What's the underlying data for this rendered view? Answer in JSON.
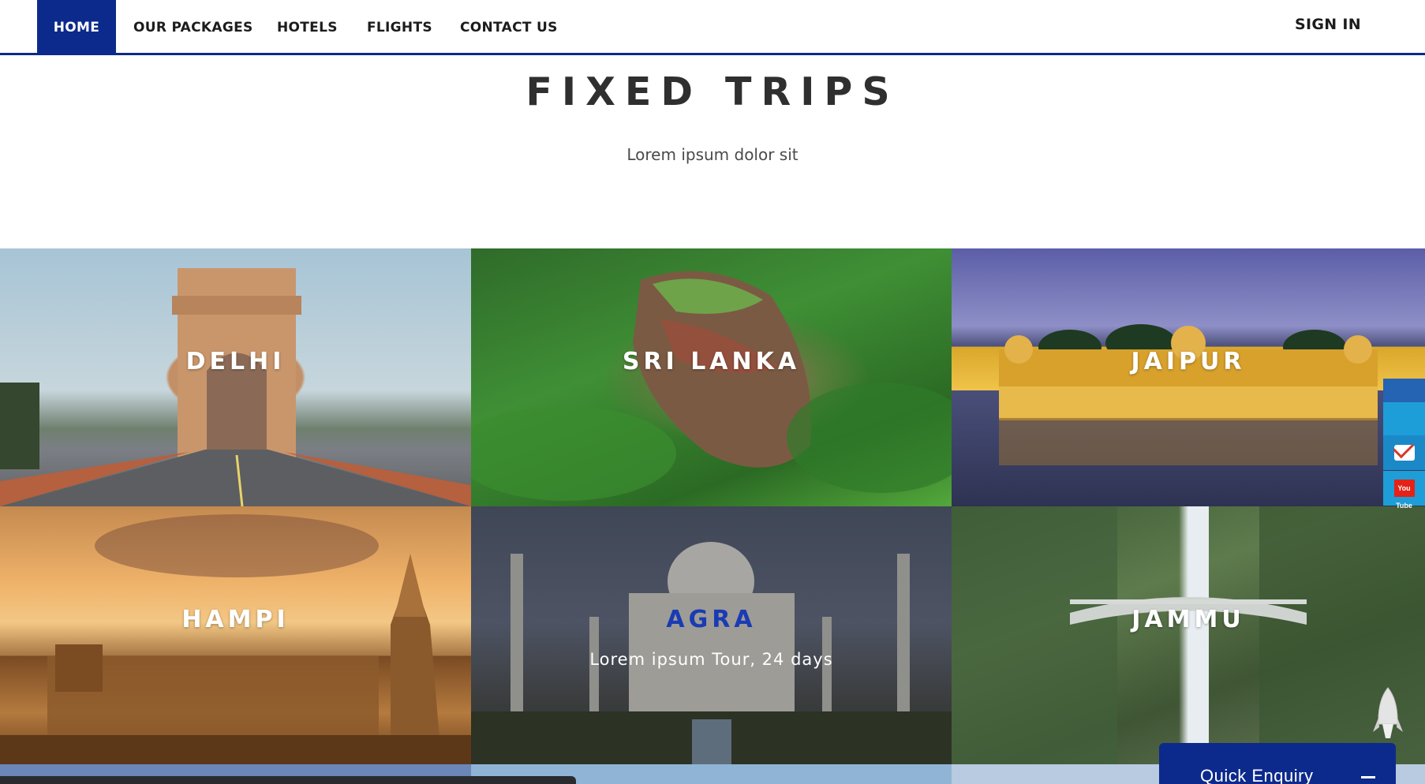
{
  "nav": {
    "home": "HOME",
    "packages": "OUR PACKAGES",
    "hotels": "HOTELS",
    "flights": "FLIGHTS",
    "contact": "CONTACT US",
    "signin": "SIGN IN",
    "active": "HOME",
    "accent_color": "#0c2a8c"
  },
  "section": {
    "title": "FIXED TRIPS",
    "subtitle": "Lorem ipsum dolor sit"
  },
  "trips": [
    {
      "name": "DELHI"
    },
    {
      "name": "SRI LANKA"
    },
    {
      "name": "JAIPUR"
    },
    {
      "name": "HAMPI"
    },
    {
      "name": "AGRA",
      "detail": "Lorem ipsum Tour, 24 days",
      "highlight_color": "#1a3bb3"
    },
    {
      "name": "JAMMU"
    }
  ],
  "social": {
    "items": [
      "twitter-icon",
      "gmail-icon",
      "youtube-icon"
    ],
    "youtube_text": "You Tube"
  },
  "enquiry": {
    "label": "Quick Enquiry"
  }
}
